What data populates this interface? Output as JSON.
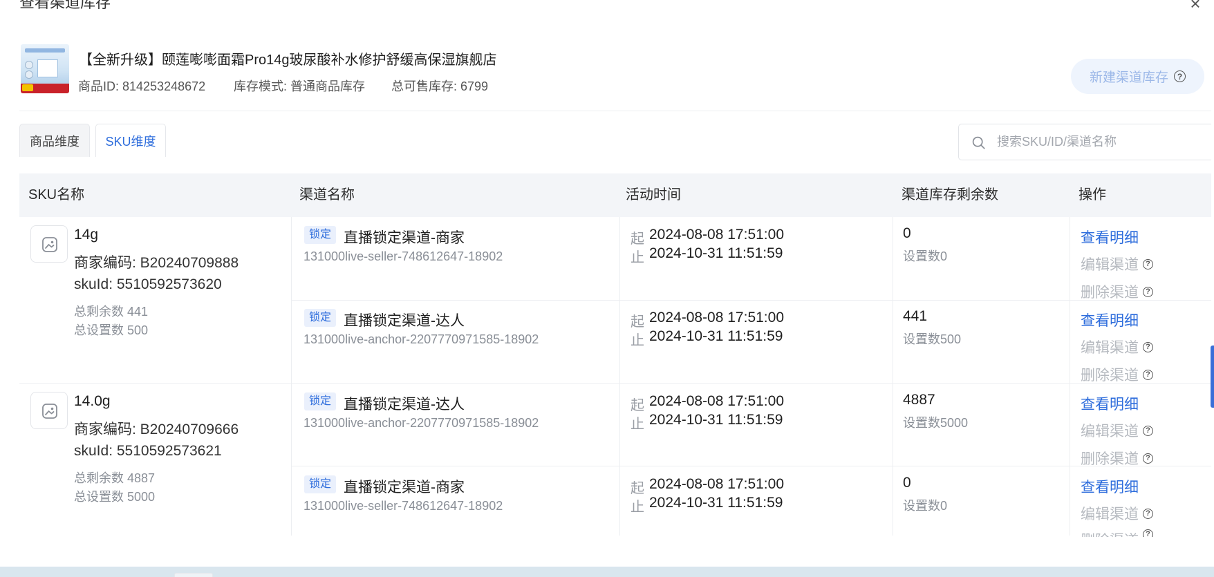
{
  "modal": {
    "title": "查看渠道库存",
    "close_label": "×"
  },
  "product": {
    "title": "【全新升级】颐莲嘭嘭面霜Pro14g玻尿酸补水修护舒缓高保湿旗舰店",
    "id_label": "商品ID: 814253248672",
    "mode_label": "库存模式: 普通商品库存",
    "total_label": "总可售库存: 6799"
  },
  "actions": {
    "new_channel": "新建渠道库存",
    "help_glyph": "?"
  },
  "tabs": [
    {
      "label": "商品维度",
      "active": false
    },
    {
      "label": "SKU维度",
      "active": true
    }
  ],
  "search": {
    "placeholder": "搜索SKU/ID/渠道名称",
    "value": ""
  },
  "table": {
    "headers": [
      "SKU名称",
      "渠道名称",
      "活动时间",
      "渠道库存剩余数",
      "操作"
    ],
    "start_label": "起",
    "end_label": "止",
    "lock_label": "锁定",
    "ops": {
      "detail": "查看明细",
      "edit": "编辑渠道",
      "delete": "删除渠道"
    },
    "skus": [
      {
        "name": "14g",
        "merchant_code": "商家编码: B20240709888",
        "sku_id": "skuId: 5510592573620",
        "remaining": "总剩余数 441",
        "set": "总设置数 500",
        "rows": [
          {
            "channel": "直播锁定渠道-商家",
            "channel_id": "131000live-seller-748612647-18902",
            "start": "2024-08-08 17:51:00",
            "end": "2024-10-31 11:51:59",
            "stock": "0",
            "set": "设置数0"
          },
          {
            "channel": "直播锁定渠道-达人",
            "channel_id": "131000live-anchor-2207770971585-18902",
            "start": "2024-08-08 17:51:00",
            "end": "2024-10-31 11:51:59",
            "stock": "441",
            "set": "设置数500"
          }
        ]
      },
      {
        "name": "14.0g",
        "merchant_code": "商家编码: B20240709666",
        "sku_id": "skuId: 5510592573621",
        "remaining": "总剩余数 4887",
        "set": "总设置数 5000",
        "rows": [
          {
            "channel": "直播锁定渠道-达人",
            "channel_id": "131000live-anchor-2207770971585-18902",
            "start": "2024-08-08 17:51:00",
            "end": "2024-10-31 11:51:59",
            "stock": "4887",
            "set": "设置数5000"
          },
          {
            "channel": "直播锁定渠道-商家",
            "channel_id": "131000live-seller-748612647-18902",
            "start": "2024-08-08 17:51:00",
            "end": "2024-10-31 11:51:59",
            "stock": "0",
            "set": "设置数0"
          }
        ]
      }
    ]
  },
  "colors": {
    "accent": "#2e6ddc",
    "muted": "#8a8f97",
    "disabled": "#b5b9bf",
    "header_bg": "#f3f5f8"
  }
}
